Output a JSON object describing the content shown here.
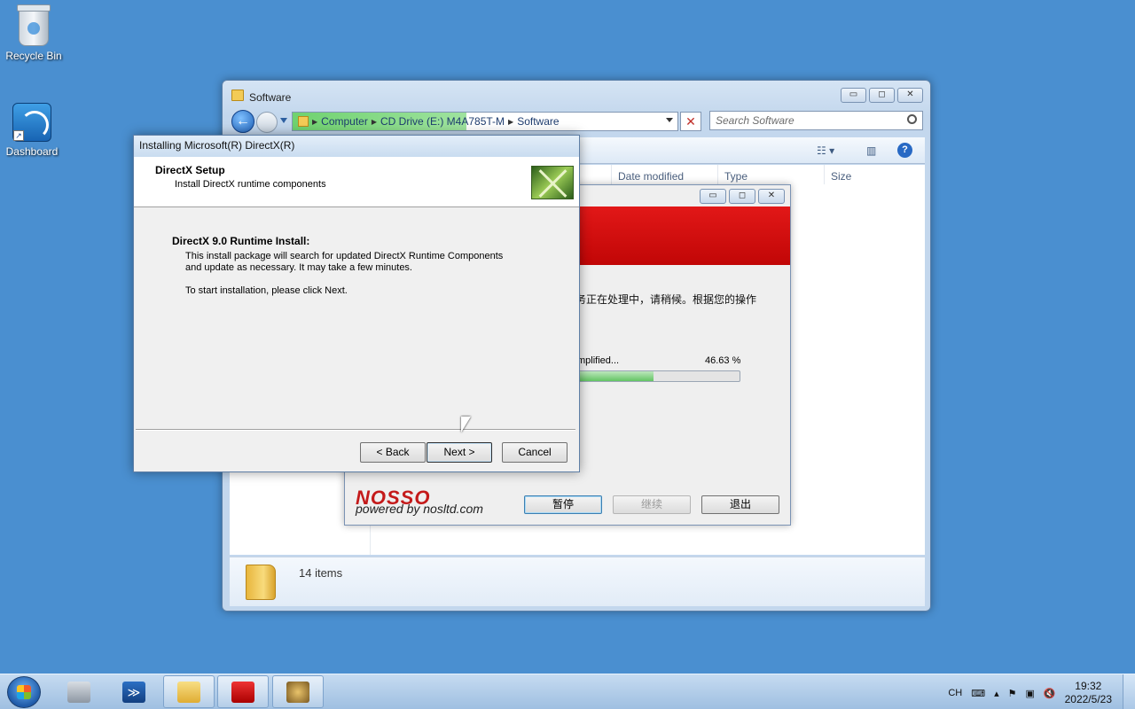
{
  "desktop": {
    "icons": [
      {
        "label": "Recycle Bin",
        "icon": "recycle-bin-icon"
      },
      {
        "label": "Dashboard",
        "icon": "dashboard-gauge-icon"
      }
    ]
  },
  "explorer": {
    "title": "Software",
    "caption_buttons": {
      "minimize": "▭",
      "maximize": "◻",
      "close": "✕"
    },
    "address": [
      "Computer",
      "CD Drive (E:) M4A785T-M",
      "Software"
    ],
    "search_placeholder": "Search Software",
    "columns": [
      "Date modified",
      "Type",
      "Size"
    ],
    "status": "14 items",
    "help_label": "?"
  },
  "installer": {
    "status_text": "务正在处理中，请稍候。根据您的操作",
    "progress_label": "mplified...",
    "progress_pct_text": "46.63 %",
    "progress_fraction": 0.4663,
    "brand": "NOSSO",
    "brand_sub": "powered by nosltd.com",
    "buttons": {
      "pause": "暂停",
      "continue": "继续",
      "exit": "退出"
    }
  },
  "directx": {
    "title": "Installing Microsoft(R) DirectX(R)",
    "header_title": "DirectX Setup",
    "header_subtitle": "Install DirectX runtime components",
    "body_title": "DirectX 9.0 Runtime Install:",
    "body_line1": "This install package will search for updated DirectX Runtime Components",
    "body_line2": "and update as necessary. It may take a few minutes.",
    "body_line3": "To start installation, please click Next.",
    "buttons": {
      "back": "< Back",
      "next": "Next >",
      "cancel": "Cancel"
    }
  },
  "taskbar": {
    "lang": "CH",
    "time": "19:32",
    "date": "2022/5/23",
    "apps": [
      "server-manager-icon",
      "powershell-icon",
      "file-explorer-icon",
      "acrobat-icon",
      "directx-setup-icon"
    ]
  }
}
